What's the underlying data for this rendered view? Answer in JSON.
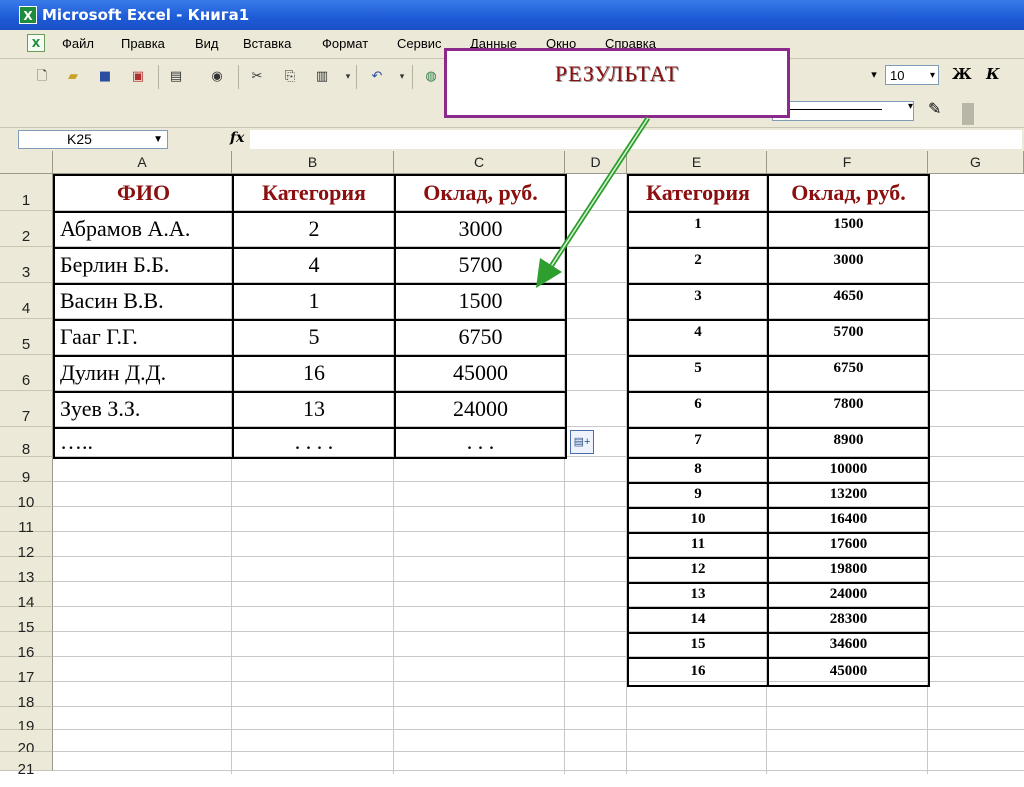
{
  "window": {
    "title": "Microsoft Excel - Книга1"
  },
  "menu": [
    "Файл",
    "Правка",
    "Вид",
    "Вставка",
    "Формат",
    "Сервис",
    "Данные",
    "Окно",
    "Справка"
  ],
  "toolbar": {
    "font_size": "10",
    "bold_label": "Ж",
    "italic_label": "К"
  },
  "formula_bar": {
    "cell_ref": "K25",
    "fx_label": "fx",
    "content": ""
  },
  "columns": [
    "A",
    "B",
    "C",
    "D",
    "E",
    "F",
    "G"
  ],
  "rows": [
    "1",
    "2",
    "3",
    "4",
    "5",
    "6",
    "7",
    "8",
    "9",
    "10",
    "11",
    "12",
    "13",
    "14",
    "15",
    "16",
    "17",
    "18",
    "19",
    "20",
    "21"
  ],
  "table1": {
    "headers": [
      "ФИО",
      "Категория",
      "Оклад, руб."
    ],
    "rows": [
      [
        "Абрамов А.А.",
        "2",
        "3000"
      ],
      [
        "Берлин Б.Б.",
        "4",
        "5700"
      ],
      [
        "Васин В.В.",
        "1",
        "1500"
      ],
      [
        "Гааг Г.Г.",
        "5",
        "6750"
      ],
      [
        "Дулин Д.Д.",
        "16",
        "45000"
      ],
      [
        "Зуев З.З.",
        "13",
        "24000"
      ],
      [
        "…..",
        ". . . .",
        ". . ."
      ]
    ]
  },
  "table2": {
    "headers": [
      "Категория",
      "Оклад, руб."
    ],
    "rows": [
      [
        "1",
        "1500"
      ],
      [
        "2",
        "3000"
      ],
      [
        "3",
        "4650"
      ],
      [
        "4",
        "5700"
      ],
      [
        "5",
        "6750"
      ],
      [
        "6",
        "7800"
      ],
      [
        "7",
        "8900"
      ],
      [
        "8",
        "10000"
      ],
      [
        "9",
        "13200"
      ],
      [
        "10",
        "16400"
      ],
      [
        "11",
        "17600"
      ],
      [
        "12",
        "19800"
      ],
      [
        "13",
        "24000"
      ],
      [
        "14",
        "28300"
      ],
      [
        "15",
        "34600"
      ],
      [
        "16",
        "45000"
      ]
    ]
  },
  "callout": {
    "text": "РЕЗУЛЬТАТ"
  },
  "colors": {
    "header_text": "#8b0f0f",
    "callout_border": "#8c2a8c",
    "arrow": "#2e9e2e"
  }
}
